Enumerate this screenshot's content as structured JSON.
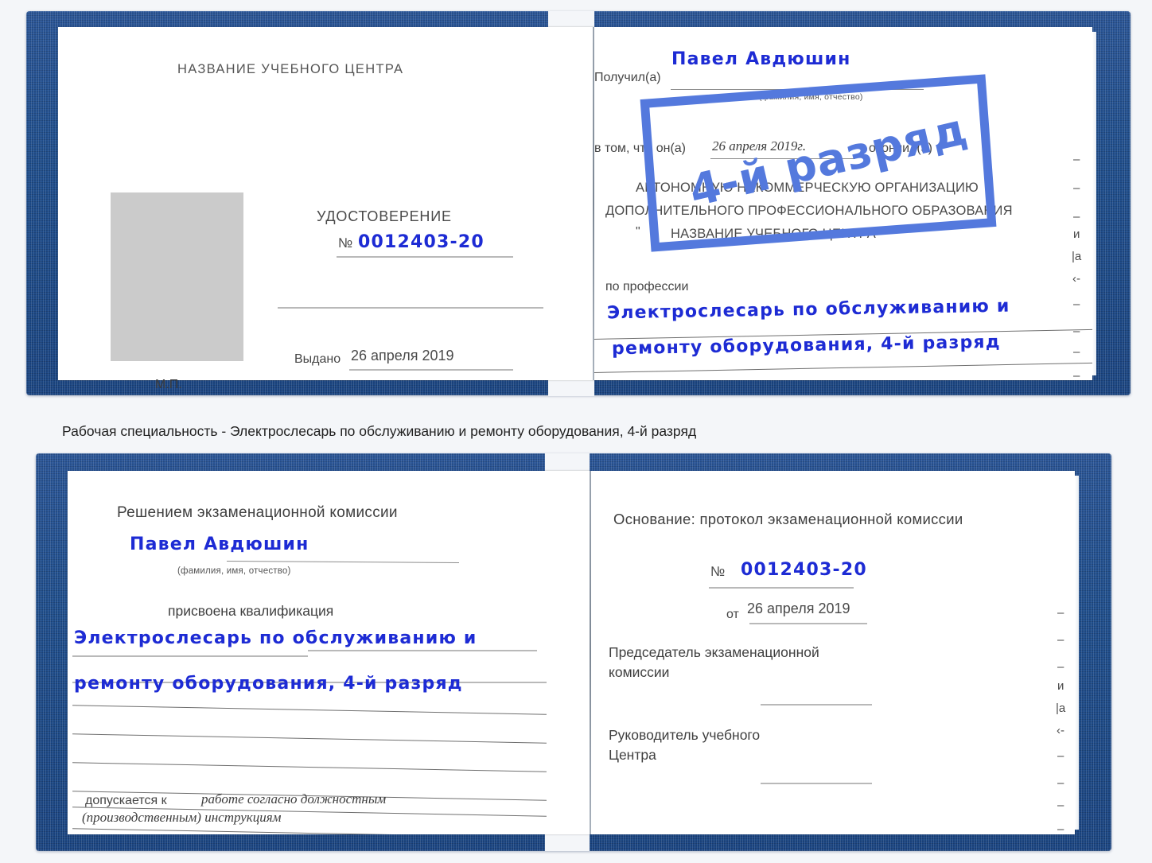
{
  "background_color": "#f4f6f9",
  "cover_color": "#1f4e8c",
  "handwriting_color": "#1d2bd4",
  "stamp": {
    "text": "4-й разряд",
    "color": "#5479dd"
  },
  "caption": {
    "text": "Рабочая специальность - Электрослесарь по обслуживанию и ремонту оборудования, 4-й разряд"
  },
  "certificate_top": {
    "left_page": {
      "heading": "НАЗВАНИЕ УЧЕБНОГО ЦЕНТРА",
      "photo_placeholder": "photo-placeholder",
      "title": "УДОСТОВЕРЕНИЕ",
      "number_label": "№",
      "number_value": "0012403-20",
      "issued_label": "Выдано",
      "issued_value": "26 апреля 2019",
      "seal_label": "М.П."
    },
    "right_page": {
      "received_label": "Получил(а)",
      "received_value": "Павел Авдюшин",
      "fio_hint": "(фамилия, имя, отчество)",
      "in_that_label": "в том, что он(а)",
      "date_value": "26 апреля 2019г.",
      "finished_label": "окончил(а)",
      "org_line1": "АВТОНОМНУЮ НЕКОММЕРЧЕСКУЮ ОРГАНИЗАЦИЮ",
      "org_line2": "ДОПОЛНИТЕЛЬНОГО ПРОФЕССИОНАЛЬНОГО ОБРАЗОВАНИЯ",
      "org_quote_open": "\"",
      "org_line3": "НАЗВАНИЕ УЧЕБНОГО ЦЕНТРА",
      "org_quote_close": "\"",
      "profession_label": "по профессии",
      "profession_line1": "Электрослесарь по обслуживанию и",
      "profession_line2": "ремонту оборудования, 4-й разряд"
    },
    "edge_fragments": [
      "–",
      "–",
      "–",
      "и",
      "|а",
      "‹-",
      "–",
      "–",
      "–",
      "–"
    ]
  },
  "certificate_bottom": {
    "left_page": {
      "heading": "Решением экзаменационной комиссии",
      "name_value": "Павел Авдюшин",
      "fio_hint": "(фамилия, имя, отчество)",
      "qualification_label": "присвоена квалификация",
      "qualification_line1": "Электрослесарь по обслуживанию и",
      "qualification_line2": "ремонту оборудования, 4-й разряд",
      "admitted_label": "допускается к",
      "admitted_line1": "работе согласно должностным",
      "admitted_line2": "(производственным) инструкциям"
    },
    "right_page": {
      "basis_label": "Основание: протокол экзаменационной комиссии",
      "number_label": "№",
      "number_value": "0012403-20",
      "from_label": "от",
      "from_value": "26 апреля 2019",
      "chairman_line1": "Председатель экзаменационной",
      "chairman_line2": "комиссии",
      "director_line1": "Руководитель учебного",
      "director_line2": "Центра"
    },
    "edge_fragments": [
      "–",
      "–",
      "–",
      "и",
      "|а",
      "‹-",
      "–",
      "–",
      "–",
      "–"
    ]
  }
}
